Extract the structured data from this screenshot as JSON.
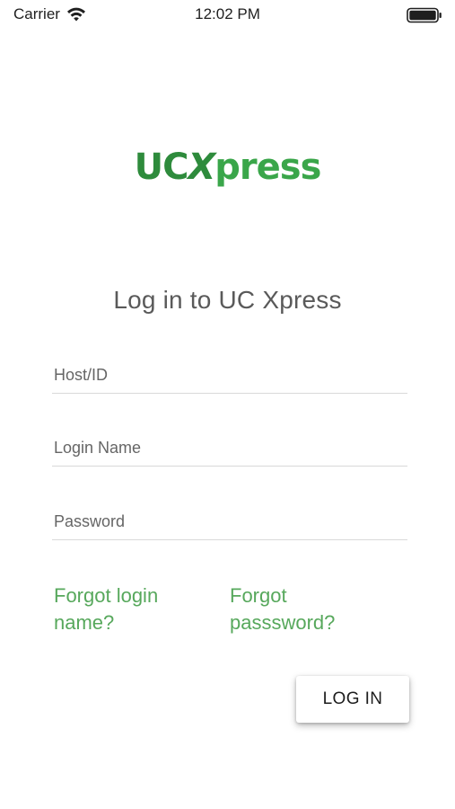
{
  "status_bar": {
    "carrier": "Carrier",
    "time": "12:02 PM",
    "wifi_icon": "wifi-icon",
    "battery_icon": "battery-icon"
  },
  "logo": {
    "part_uc": "UC",
    "part_x": "X",
    "part_rest": "press",
    "color_primary": "#2e8b3c",
    "color_secondary": "#3aa64a"
  },
  "title": "Log in to UC Xpress",
  "form": {
    "host": {
      "placeholder": "Host/ID",
      "value": ""
    },
    "login_name": {
      "placeholder": "Login Name",
      "value": ""
    },
    "password": {
      "placeholder": "Password",
      "value": ""
    }
  },
  "links": {
    "forgot_login": "Forgot login name?",
    "forgot_password": "Forgot passsword?",
    "color": "#57a85c"
  },
  "button": {
    "label": "LOG IN"
  }
}
